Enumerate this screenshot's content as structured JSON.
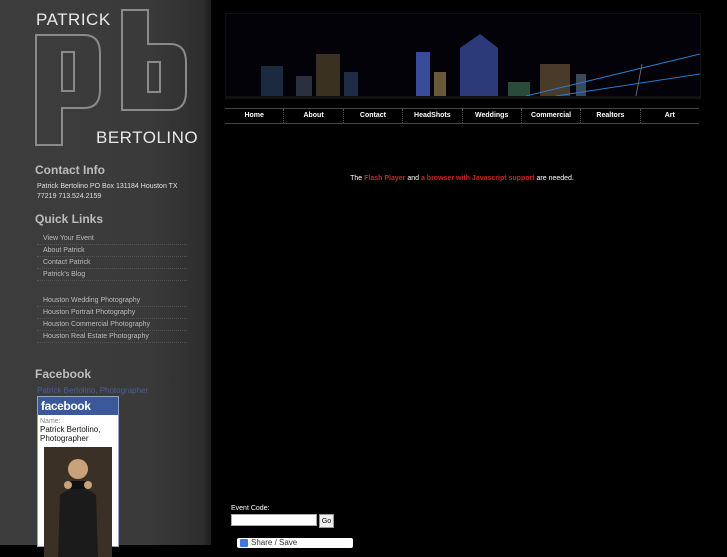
{
  "logo": {
    "first": "PATRICK",
    "monogram": "pb",
    "last": "BERTOLINO"
  },
  "contact": {
    "title": "Contact Info",
    "text": "Patrick Bertolino PO Box 131184 Houston TX 77219 713.524.2159"
  },
  "quick_links": {
    "title": "Quick Links",
    "group1": [
      "View Your Event",
      "About Patrick",
      "Contact Patrick",
      "Patrick's Blog"
    ],
    "group2": [
      "Houston Wedding Photography",
      "Houston Portrait Photography",
      "Houston Commercial Photography",
      "Houston Real Estate Photography"
    ]
  },
  "facebook": {
    "title": "Facebook",
    "link": "Patrick Bertolino, Photographer",
    "brand": "facebook",
    "name_label": "Name:",
    "name": "Patrick Bertolino, Photographer"
  },
  "nav": [
    "Home",
    "About",
    "Contact",
    "HeadShots",
    "Weddings",
    "Commercial",
    "Realtors",
    "Art"
  ],
  "flash": {
    "pre": "The",
    "link1": "Flash Player",
    "mid": "and",
    "link2": "a browser with Javascript support",
    "post": "are needed."
  },
  "event": {
    "label": "Event Code:",
    "value": "",
    "go": "Go"
  },
  "share": {
    "label": "Share / Save"
  },
  "colors": {
    "accent_red": "#c8281e",
    "facebook_blue": "#3b5998"
  }
}
